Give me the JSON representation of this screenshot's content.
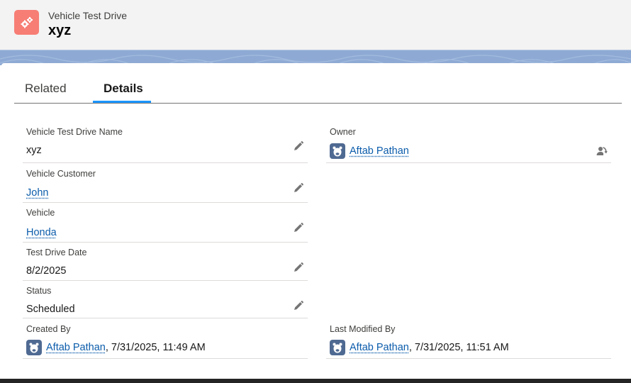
{
  "header": {
    "object_type": "Vehicle Test Drive",
    "record_name": "xyz"
  },
  "tabs": [
    {
      "label": "Related",
      "active": false
    },
    {
      "label": "Details",
      "active": true
    }
  ],
  "fields": {
    "vehicle_test_drive_name": {
      "label": "Vehicle Test Drive Name",
      "value": "xyz"
    },
    "owner": {
      "label": "Owner",
      "value": "Aftab Pathan"
    },
    "vehicle_customer": {
      "label": "Vehicle Customer",
      "value": "John"
    },
    "vehicle": {
      "label": "Vehicle",
      "value": "Honda"
    },
    "test_drive_date": {
      "label": "Test Drive Date",
      "value": "8/2/2025"
    },
    "status": {
      "label": "Status",
      "value": "Scheduled"
    },
    "created_by": {
      "label": "Created By",
      "user": "Aftab Pathan",
      "timestamp": ", 7/31/2025, 11:49 AM"
    },
    "last_modified_by": {
      "label": "Last Modified By",
      "user": "Aftab Pathan",
      "timestamp": ", 7/31/2025, 11:51 AM"
    }
  },
  "colors": {
    "object_icon": "#f77e75",
    "link": "#0b5cab",
    "active_tab_underline": "#1b96ff",
    "avatar": "#4f6a92",
    "band": "#8eaad4"
  },
  "icons": {
    "object": "gear-icon",
    "edit": "pencil-icon",
    "avatar": "user-avatar-icon",
    "change_owner": "change-owner-icon"
  }
}
